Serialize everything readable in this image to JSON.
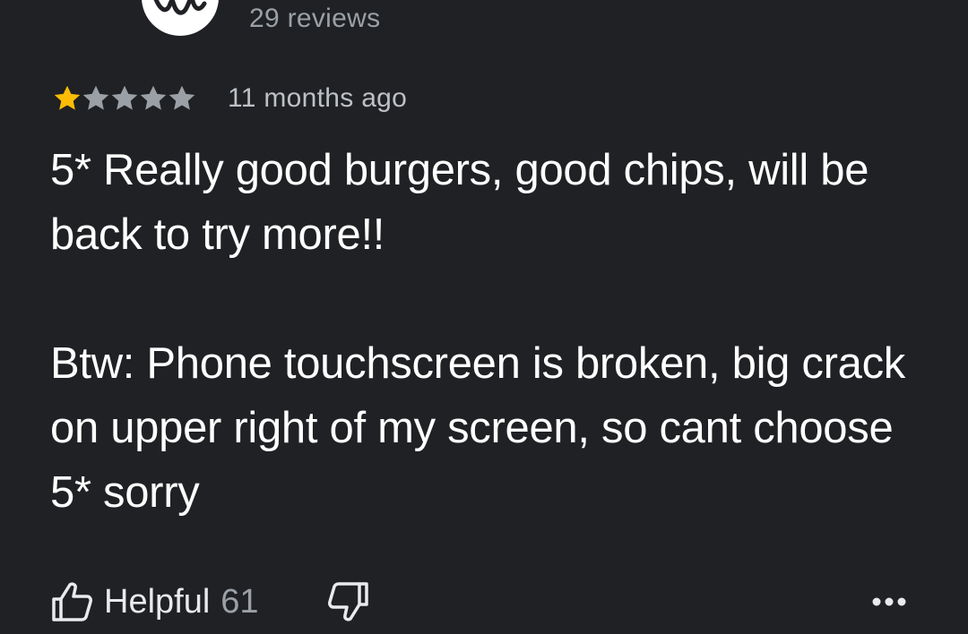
{
  "reviewer": {
    "review_count": "29 reviews",
    "avatar_icon": "avatar-logo"
  },
  "review": {
    "rating": 1,
    "rating_max": 5,
    "timestamp": "11 months ago",
    "paragraphs": [
      "5* Really good burgers, good chips, will be back to try more!!",
      "Btw: Phone touchscreen is broken, big crack on upper right of my screen, so cant choose 5* sorry"
    ]
  },
  "actions": {
    "helpful_label": "Helpful",
    "helpful_count": "61",
    "like_icon": "thumb-up-icon",
    "dislike_icon": "thumb-down-icon",
    "more_icon": "more-options-icon"
  },
  "colors": {
    "background": "#202124",
    "star_filled": "#fbbc04",
    "star_empty": "#9aa0a6",
    "text_primary": "#ffffff",
    "text_secondary": "#9aa0a6"
  }
}
